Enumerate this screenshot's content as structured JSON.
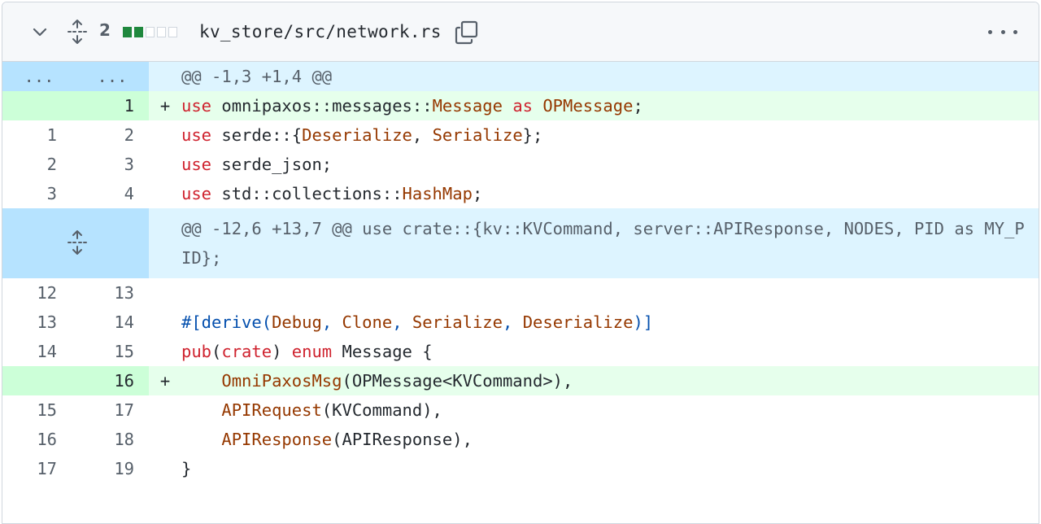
{
  "file_header": {
    "expand_icon": "chevron-down-icon",
    "expand_all_icon": "unfold-icon",
    "changes_count": "2",
    "diffstat": [
      "added",
      "added",
      "neutral",
      "neutral",
      "neutral"
    ],
    "filename": "kv_store/src/network.rs",
    "copy_icon": "copy-icon",
    "menu_icon": "kebab-horizontal-icon"
  },
  "colors": {
    "added_bg": "#e6ffec",
    "added_gutter": "#ccffd8",
    "hunk_bg": "#ddf4ff",
    "hunk_gutter": "#b6e3ff",
    "keyword": "#cf222e",
    "type": "#953800",
    "macro": "#0550ae"
  },
  "hunk1": {
    "old_expand": "...",
    "new_expand": "...",
    "header": "@@ -1,3 +1,4 @@"
  },
  "lines1": [
    {
      "old": "",
      "new": "1",
      "marker": "+",
      "type": "add",
      "tokens": [
        [
          "k",
          "use"
        ],
        [
          "p",
          " omnipaxos::messages::"
        ],
        [
          "t",
          "Message"
        ],
        [
          "p",
          " "
        ],
        [
          "k",
          "as"
        ],
        [
          "p",
          " "
        ],
        [
          "t",
          "OPMessage"
        ],
        [
          "p",
          ";"
        ]
      ]
    },
    {
      "old": "1",
      "new": "2",
      "marker": "",
      "type": "ctx",
      "tokens": [
        [
          "k",
          "use"
        ],
        [
          "p",
          " serde::{"
        ],
        [
          "t",
          "Deserialize"
        ],
        [
          "p",
          ", "
        ],
        [
          "t",
          "Serialize"
        ],
        [
          "p",
          "};"
        ]
      ]
    },
    {
      "old": "2",
      "new": "3",
      "marker": "",
      "type": "ctx",
      "tokens": [
        [
          "k",
          "use"
        ],
        [
          "p",
          " serde_json;"
        ]
      ]
    },
    {
      "old": "3",
      "new": "4",
      "marker": "",
      "type": "ctx",
      "tokens": [
        [
          "k",
          "use"
        ],
        [
          "p",
          " std::collections::"
        ],
        [
          "t",
          "HashMap"
        ],
        [
          "p",
          ";"
        ]
      ]
    }
  ],
  "hunk2": {
    "header": "@@ -12,6 +13,7 @@ use crate::{kv::KVCommand, server::APIResponse, NODES, PID as MY_PID};"
  },
  "lines2": [
    {
      "old": "12",
      "new": "13",
      "marker": "",
      "type": "ctx",
      "tokens": []
    },
    {
      "old": "13",
      "new": "14",
      "marker": "",
      "type": "ctx",
      "tokens": [
        [
          "m",
          "#[derive("
        ],
        [
          "t",
          "Debug"
        ],
        [
          "m",
          ", "
        ],
        [
          "t",
          "Clone"
        ],
        [
          "m",
          ", "
        ],
        [
          "t",
          "Serialize"
        ],
        [
          "m",
          ", "
        ],
        [
          "t",
          "Deserialize"
        ],
        [
          "m",
          ")]"
        ]
      ]
    },
    {
      "old": "14",
      "new": "15",
      "marker": "",
      "type": "ctx",
      "tokens": [
        [
          "k",
          "pub"
        ],
        [
          "p",
          "("
        ],
        [
          "k",
          "crate"
        ],
        [
          "p",
          ") "
        ],
        [
          "k",
          "enum"
        ],
        [
          "p",
          " Message {"
        ]
      ]
    },
    {
      "old": "",
      "new": "16",
      "marker": "+",
      "type": "add",
      "tokens": [
        [
          "p",
          "    "
        ],
        [
          "t",
          "OmniPaxosMsg"
        ],
        [
          "p",
          "(OPMessage<KVCommand>),"
        ]
      ]
    },
    {
      "old": "15",
      "new": "17",
      "marker": "",
      "type": "ctx",
      "tokens": [
        [
          "p",
          "    "
        ],
        [
          "t",
          "APIRequest"
        ],
        [
          "p",
          "(KVCommand),"
        ]
      ]
    },
    {
      "old": "16",
      "new": "18",
      "marker": "",
      "type": "ctx",
      "tokens": [
        [
          "p",
          "    "
        ],
        [
          "t",
          "APIResponse"
        ],
        [
          "p",
          "(APIResponse),"
        ]
      ]
    },
    {
      "old": "17",
      "new": "19",
      "marker": "",
      "type": "ctx",
      "tokens": [
        [
          "p",
          "}"
        ]
      ]
    }
  ]
}
